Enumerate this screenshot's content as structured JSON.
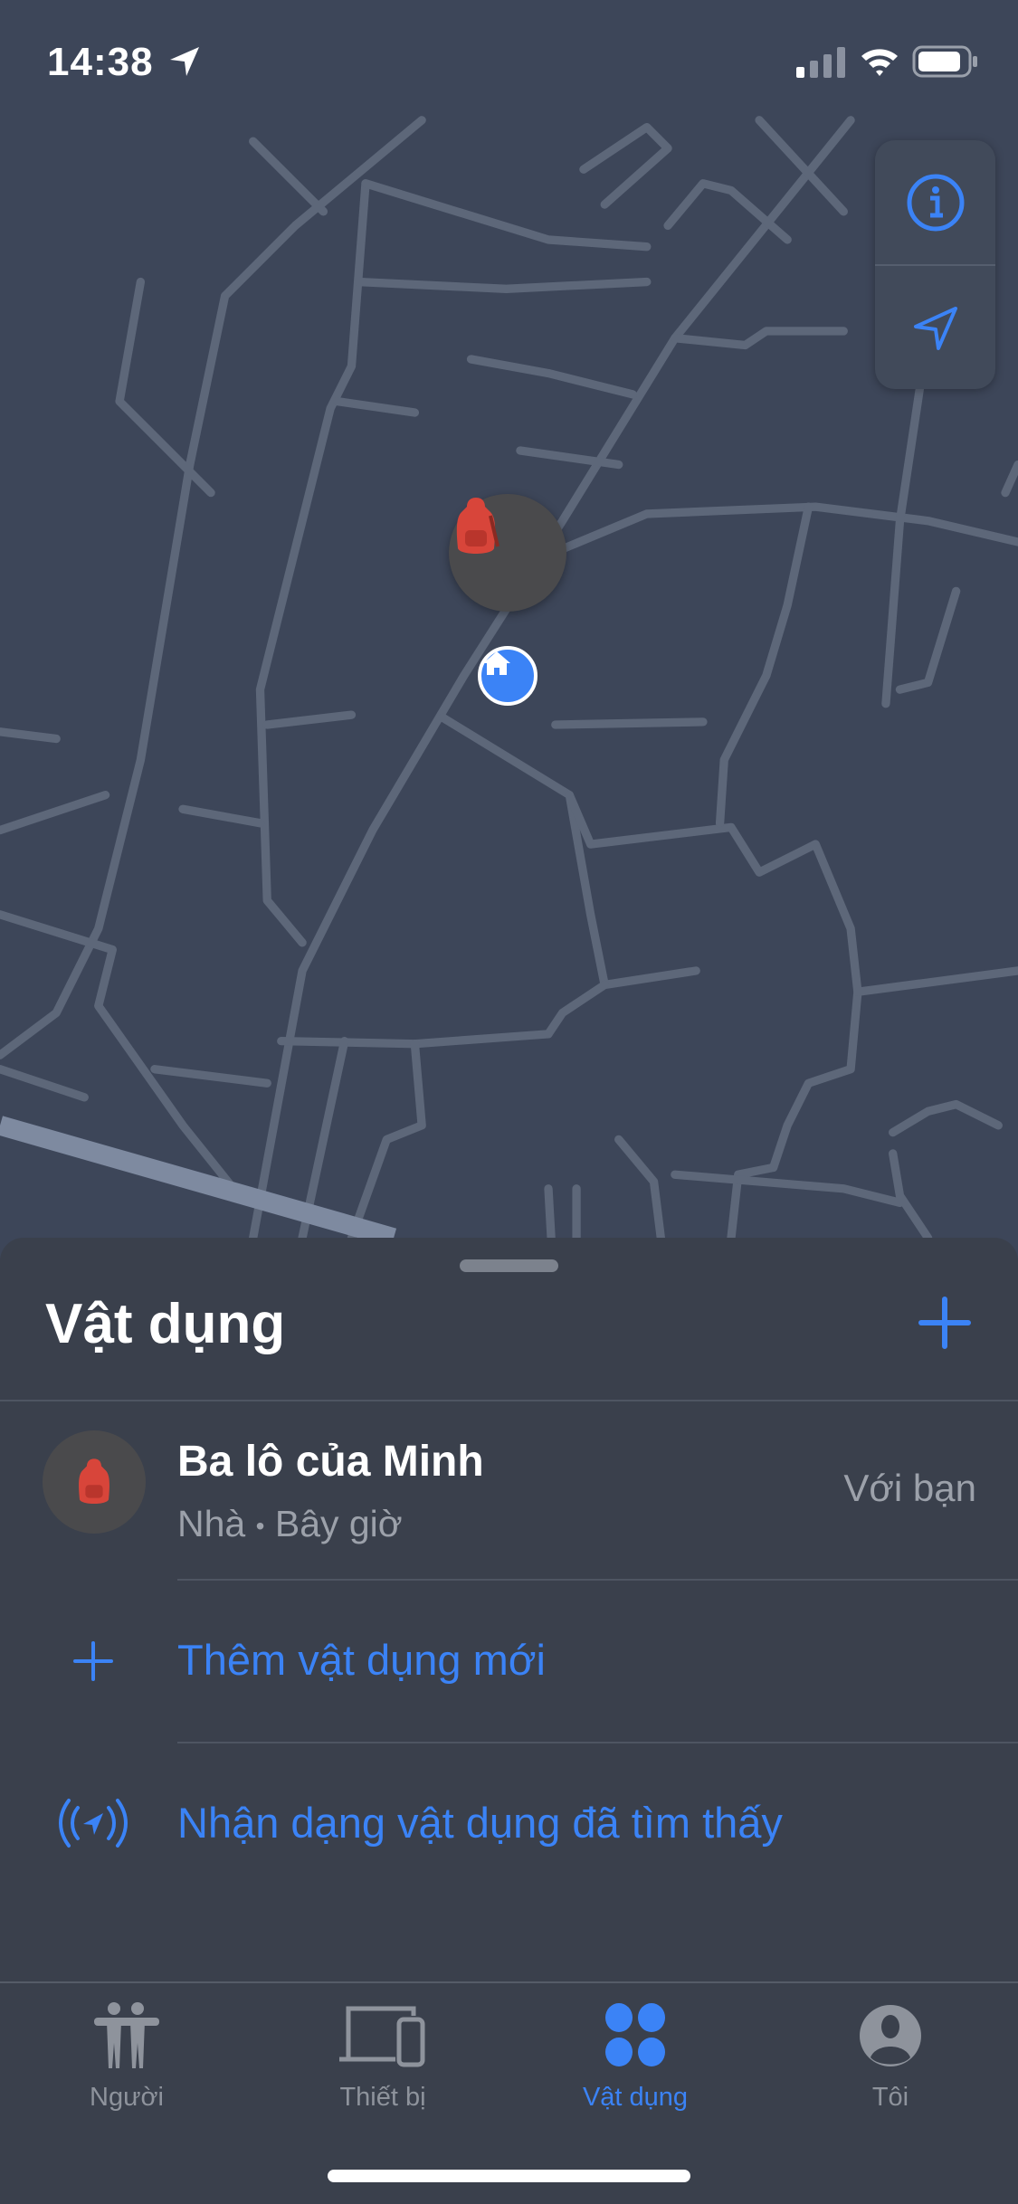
{
  "status_bar": {
    "time": "14:38",
    "icons": [
      "location-arrow-icon",
      "signal-icon",
      "wifi-icon",
      "battery-icon"
    ]
  },
  "map": {
    "controls": [
      "info-icon",
      "location-arrow-icon"
    ],
    "pins": [
      {
        "item": "backpack-icon"
      },
      {
        "item": "home-icon"
      }
    ]
  },
  "sheet": {
    "title": "Vật dụng",
    "add_icon": "plus-icon",
    "items": [
      {
        "name": "Ba lô của Minh",
        "location": "Nhà",
        "separator": "•",
        "time": "Bây giờ",
        "status": "Với bạn",
        "icon": "backpack-icon"
      }
    ],
    "actions": [
      {
        "label": "Thêm vật dụng mới",
        "icon": "plus-icon"
      },
      {
        "label": "Nhận dạng vật dụng đã tìm thấy",
        "icon": "identify-item-icon"
      }
    ]
  },
  "tabs": [
    {
      "label": "Người",
      "active": false
    },
    {
      "label": "Thiết bị",
      "active": false
    },
    {
      "label": "Vật dụng",
      "active": true
    },
    {
      "label": "Tôi",
      "active": false
    }
  ],
  "colors": {
    "accent": "#3b83f6",
    "map_bg": "#3d4659",
    "sheet_bg": "#3a404c"
  }
}
